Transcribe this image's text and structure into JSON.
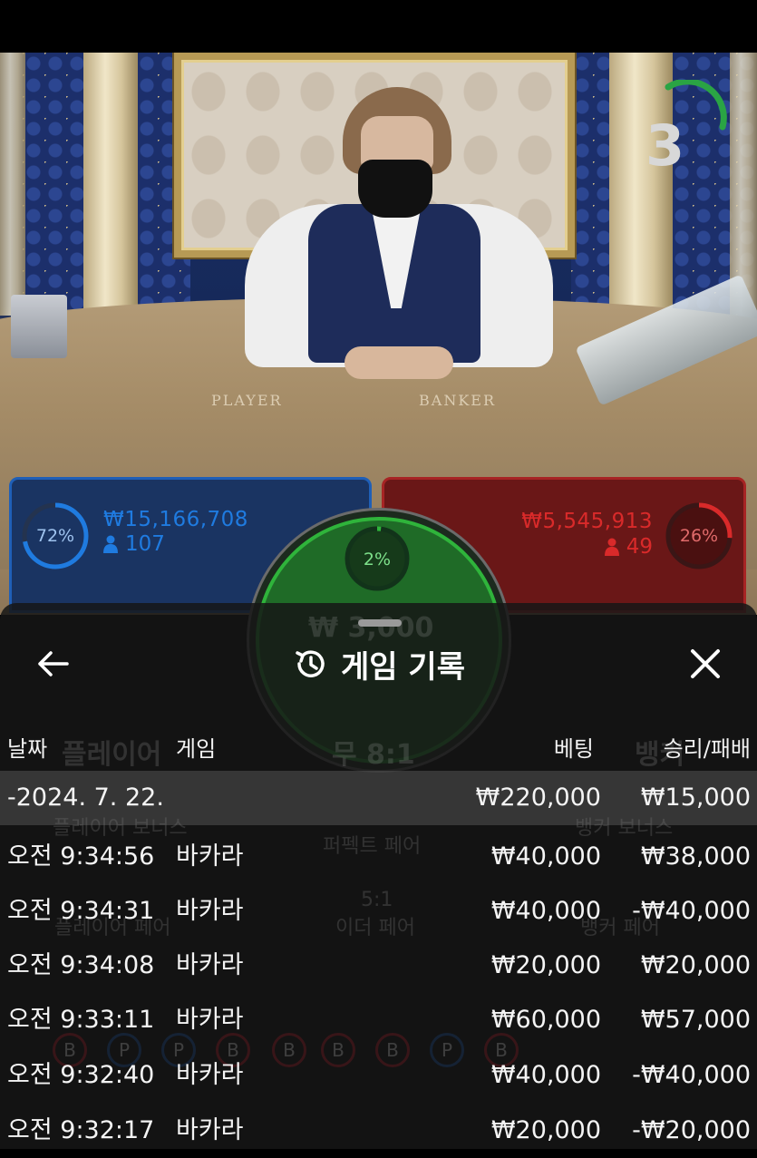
{
  "timer": {
    "value": "3"
  },
  "table_labels": {
    "player": "PLAYER",
    "banker": "BANKER"
  },
  "player": {
    "percent": "72%",
    "amount": "₩15,166,708",
    "bettors": "107",
    "color": "#1f7be0"
  },
  "banker": {
    "percent": "26%",
    "amount": "₩5,545,913",
    "bettors": "49",
    "color": "#d92a2a"
  },
  "tie": {
    "percent": "2%",
    "color": "#2fb43b"
  },
  "history": {
    "title": "게임 기록",
    "columns": {
      "date": "날짜",
      "game": "게임",
      "bet": "베팅",
      "win_loss": "승리/패배"
    },
    "date_group": {
      "date": "-2024. 7. 22.",
      "bet": "₩220,000",
      "result": "₩15,000"
    },
    "rows": [
      {
        "time": "오전 9:34:56",
        "game": "바카라",
        "bet": "₩40,000",
        "result": "₩38,000"
      },
      {
        "time": "오전 9:34:31",
        "game": "바카라",
        "bet": "₩40,000",
        "result": "-₩40,000"
      },
      {
        "time": "오전 9:34:08",
        "game": "바카라",
        "bet": "₩20,000",
        "result": "₩20,000"
      },
      {
        "time": "오전 9:33:11",
        "game": "바카라",
        "bet": "₩60,000",
        "result": "₩57,000"
      },
      {
        "time": "오전 9:32:40",
        "game": "바카라",
        "bet": "₩40,000",
        "result": "-₩40,000"
      },
      {
        "time": "오전 9:32:17",
        "game": "바카라",
        "bet": "₩20,000",
        "result": "-₩20,000"
      }
    ]
  },
  "icons": {
    "back": "arrow-left-icon",
    "history": "history-clock-icon",
    "close": "close-icon"
  }
}
